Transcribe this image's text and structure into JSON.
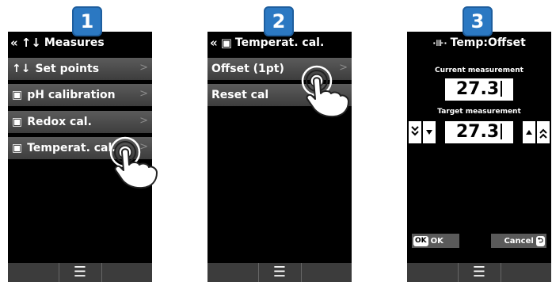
{
  "steps": [
    "1",
    "2",
    "3"
  ],
  "screen1": {
    "title_glyph": "«",
    "title_icon": "↑↓",
    "title": "Measures",
    "items": [
      {
        "icon": "↑↓",
        "label": "Set points"
      },
      {
        "icon": "▣",
        "label": "pH calibration"
      },
      {
        "icon": "▣",
        "label": "Redox cal."
      },
      {
        "icon": "▣",
        "label": "Temperat. cal."
      }
    ],
    "chevron": ">"
  },
  "screen2": {
    "title_glyph": "«",
    "title_icon": "▣",
    "title": "Temperat. cal.",
    "items": [
      {
        "label": "Offset (1pt)"
      },
      {
        "label": "Reset cal"
      }
    ],
    "chevron": ">"
  },
  "screen3": {
    "title_icon": "·⊪·",
    "title": "Temp:Offset",
    "current_label": "Current measurement",
    "current_value": "27.3",
    "target_label": "Target measurement",
    "target_value": "27.3",
    "ok_tag": "OK",
    "ok_label": "OK",
    "cancel_label": "Cancel",
    "cancel_tag": "⮌"
  },
  "bottom_icon": "☰",
  "colors": {
    "badge": "#2b78c2",
    "menu_item": "#4a4a4a",
    "screen_bg": "#000000",
    "bottom_bar": "#3c3c3c"
  }
}
